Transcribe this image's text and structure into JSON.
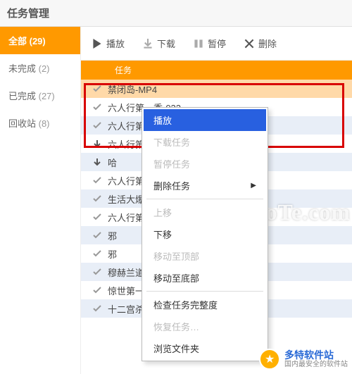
{
  "header": {
    "title": "任务管理"
  },
  "sidebar": {
    "items": [
      {
        "label": "全部",
        "count": "(29)",
        "active": true
      },
      {
        "label": "未完成",
        "count": "(2)"
      },
      {
        "label": "已完成",
        "count": "(27)"
      },
      {
        "label": "回收站",
        "count": "(8)"
      }
    ]
  },
  "toolbar": {
    "play": "播放",
    "download": "下载",
    "pause": "暂停",
    "delete": "删除"
  },
  "task_header": "任务",
  "tasks": [
    {
      "status": "done",
      "name": "禁闭岛-MP4",
      "selected": true
    },
    {
      "status": "done",
      "name": "六人行第一季-022"
    },
    {
      "status": "done",
      "name": "六人行第一季-021"
    },
    {
      "status": "down",
      "name": "六人行第一季-020"
    },
    {
      "status": "down",
      "name": "哈"
    },
    {
      "status": "done",
      "name": "六人行第一季"
    },
    {
      "status": "done",
      "name": "生活大爆炸-005"
    },
    {
      "status": "done",
      "name": "六人行第一季"
    },
    {
      "status": "done",
      "name": "邪"
    },
    {
      "status": "done",
      "name": "邪"
    },
    {
      "status": "done",
      "name": "穆赫兰道"
    },
    {
      "status": "done",
      "name": "惊世第一季-001"
    },
    {
      "status": "done",
      "name": "十二宫杀手-MP4"
    }
  ],
  "context_menu": {
    "items": [
      {
        "label": "播放",
        "highlight": true
      },
      {
        "label": "下载任务",
        "disabled": true
      },
      {
        "label": "暂停任务",
        "disabled": true
      },
      {
        "label": "删除任务",
        "submenu": true
      },
      {
        "sep": true
      },
      {
        "label": "上移",
        "disabled": true
      },
      {
        "label": "下移"
      },
      {
        "label": "移动至顶部",
        "disabled": true
      },
      {
        "label": "移动至底部"
      },
      {
        "sep": true
      },
      {
        "label": "检查任务完整度"
      },
      {
        "label": "恢复任务…",
        "disabled": true
      },
      {
        "label": "浏览文件夹"
      }
    ]
  },
  "watermark": "www.DuoTe.com",
  "badge": {
    "title": "多特软件站",
    "sub": "国内最安全的软件站",
    "url": "DuoTe.com"
  }
}
